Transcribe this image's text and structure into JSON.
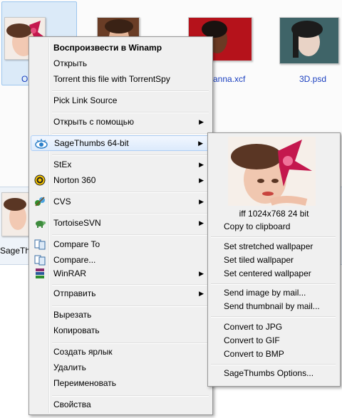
{
  "files": {
    "selected_name_partial": "Or",
    "file3_name": "anna.xcf",
    "file4_name": "3D.psd",
    "strip_name_partial": "SageThu"
  },
  "context_menu": {
    "items": [
      {
        "label": "Воспроизвести в Winamp",
        "bold": true
      },
      {
        "label": "Открыть"
      },
      {
        "label": "Torrent this file with TorrentSpy"
      },
      {
        "label": "Pick Link Source"
      },
      {
        "label": "Открыть с помощью",
        "submenu": true
      },
      {
        "label": "SageThumbs 64-bit",
        "submenu": true,
        "highlighted": true,
        "icon": "sagethumbs-eye-icon"
      },
      {
        "label": "StEx",
        "submenu": true
      },
      {
        "label": "Norton 360",
        "submenu": true,
        "icon": "norton-icon"
      },
      {
        "label": "CVS",
        "submenu": true,
        "icon": "cvs-icon"
      },
      {
        "label": "TortoiseSVN",
        "submenu": true,
        "icon": "tortoisesvn-icon"
      },
      {
        "label": "Compare To",
        "icon": "compare-icon"
      },
      {
        "label": "Compare...",
        "icon": "compare-icon"
      },
      {
        "label": "WinRAR",
        "submenu": true,
        "icon": "winrar-icon"
      },
      {
        "label": "Отправить",
        "submenu": true
      },
      {
        "label": "Вырезать"
      },
      {
        "label": "Копировать"
      },
      {
        "label": "Создать ярлык"
      },
      {
        "label": "Удалить"
      },
      {
        "label": "Переименовать"
      },
      {
        "label": "Свойства"
      }
    ],
    "arrow": "▶"
  },
  "submenu": {
    "image_info": "iff 1024x768 24 bit",
    "items": [
      "Copy to clipboard",
      "Set stretched wallpaper",
      "Set tiled wallpaper",
      "Set centered wallpaper",
      "Send image by mail...",
      "Send thumbnail by mail...",
      "Convert to JPG",
      "Convert to GIF",
      "Convert to BMP",
      "SageThumbs Options..."
    ]
  },
  "colors": {
    "highlight_border": "#aecff7",
    "link_blue": "#1a3fbf",
    "menu_bg": "#f0f0f0"
  }
}
